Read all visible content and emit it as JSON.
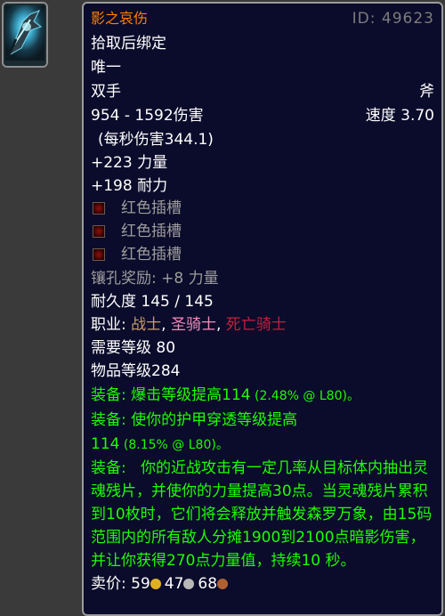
{
  "item": {
    "name": "影之哀伤",
    "id_label": "ID: 49623",
    "bind": "拾取后绑定",
    "unique": "唯一",
    "slot": "双手",
    "type": "斧",
    "damage": "954 - 1592伤害",
    "speed": "速度 3.70",
    "dps": "(每秒伤害344.1)",
    "stat1": "+223 力量",
    "stat2": "+198 耐力",
    "socket_label": "红色插槽",
    "socket_bonus": "镶孔奖励: +8 力量",
    "durability": "耐久度 145 / 145",
    "classes_label": "职业: ",
    "class1": "战士",
    "sep1": ", ",
    "class2": "圣骑士",
    "sep2": ", ",
    "class3": "死亡骑士",
    "req_level": "需要等级 80",
    "item_level": "物品等级284",
    "equip1": "装备:   爆击等级提高114",
    "equip1_note": " (2.48% @ L80)。",
    "equip2_line1": "装备:   使你的护甲穿透等级提高",
    "equip2_line2": "114",
    "equip2_note": " (8.15% @ L80)。",
    "equip3": "装备:   你的近战攻击有一定几率从目标体内抽出灵魂残片，并使你的力量提高30点。当灵魂残片累积到10枚时，它们将会释放并触发森罗万象，由15码范围内的所有敌人分摊1900到2100点暗影伤害，并让你获得270点力量值，持续10 秒。",
    "sell_label": "卖价:",
    "gold": "59",
    "silver": "47",
    "copper": "68"
  },
  "colors": {
    "name": "#ff8000",
    "equip": "#1eff00",
    "socket_bonus": "#9d9d9d",
    "warrior": "#c79c6e",
    "paladin": "#f58cba",
    "death_knight": "#c41f3b"
  },
  "icons": {
    "item_icon": "axe-item-icon",
    "socket_icon": "red-socket-icon"
  }
}
